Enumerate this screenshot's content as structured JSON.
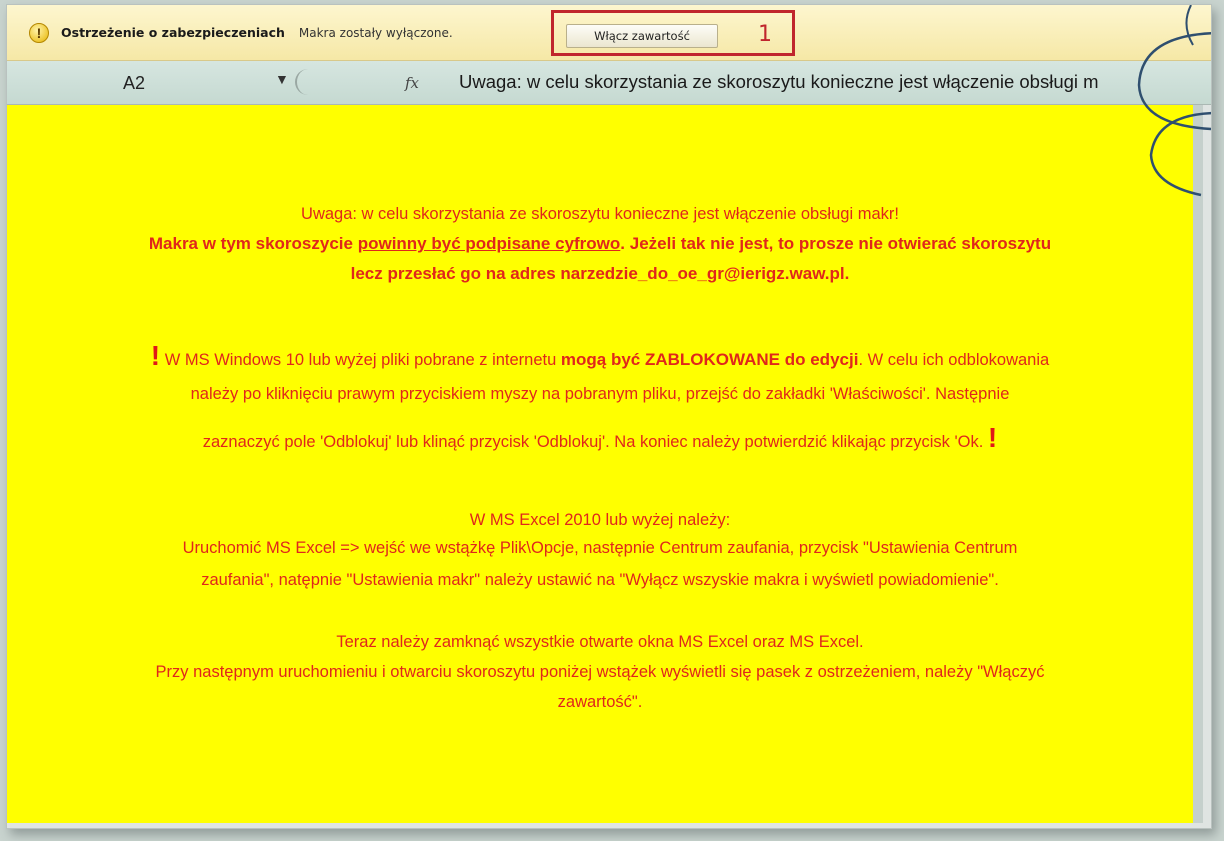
{
  "security_bar": {
    "title": "Ostrzeżenie o zabezpieczeniach",
    "message": "Makra zostały wyłączone.",
    "enable_button": "Włącz zawartość",
    "callout_number": "1",
    "warning_icon": "shield-warning-icon"
  },
  "formula_bar": {
    "cell_ref": "A2",
    "fx_label": "fx",
    "formula_text": "Uwaga: w celu skorzystania ze skoroszytu konieczne jest włączenie obsługi m"
  },
  "sheet": {
    "background_color": "#ffff00",
    "text_color": "#e0271b",
    "line1": "Uwaga: w celu skorzystania ze skoroszytu konieczne jest włączenie obsługi makr!",
    "line2_a": "Makra w tym skoroszycie ",
    "line2_u": "powinny być podpisane cyfrowo",
    "line2_b": ". Jeżeli tak nie jest, to prosze nie otwierać skoroszytu",
    "line3": "lecz przesłać go na adres narzedzie_do_oe_gr@ierigz.waw.pl.",
    "line4_excl": "!",
    "line4_a": " W MS Windows 10 lub wyżej pliki pobrane z internetu ",
    "line4_b": "mogą być ZABLOKOWANE do edycji",
    "line4_c": ". W celu ich odblokowania",
    "line5": "należy po kliknięciu prawym przyciskiem myszy na pobranym pliku, przejść do zakładki 'Właściwości'. Następnie",
    "line6": "zaznaczyć pole 'Odblokuj' lub klinąć przycisk 'Odblokuj'. Na koniec należy potwierdzić klikając przycisk 'Ok.",
    "line6_excl": "!",
    "line7": "W MS Excel 2010 lub wyżej należy:",
    "line8": "Uruchomić MS Excel => wejść we wstążkę Plik\\Opcje, następnie Centrum zaufania, przycisk \"Ustawienia Centrum",
    "line9": "zaufania\", natępnie \"Ustawienia makr\" należy ustawić na \"Wyłącz wszyskie makra i wyświetl powiadomienie\".",
    "line10": "Teraz należy zamknąć wszystkie otwarte okna MS Excel oraz MS Excel.",
    "line11": "Przy następnym uruchomieniu i otwarciu skoroszytu poniżej wstążek wyświetli się pasek z ostrzeżeniem, należy \"Włączyć",
    "line12": "zawartość\"."
  }
}
